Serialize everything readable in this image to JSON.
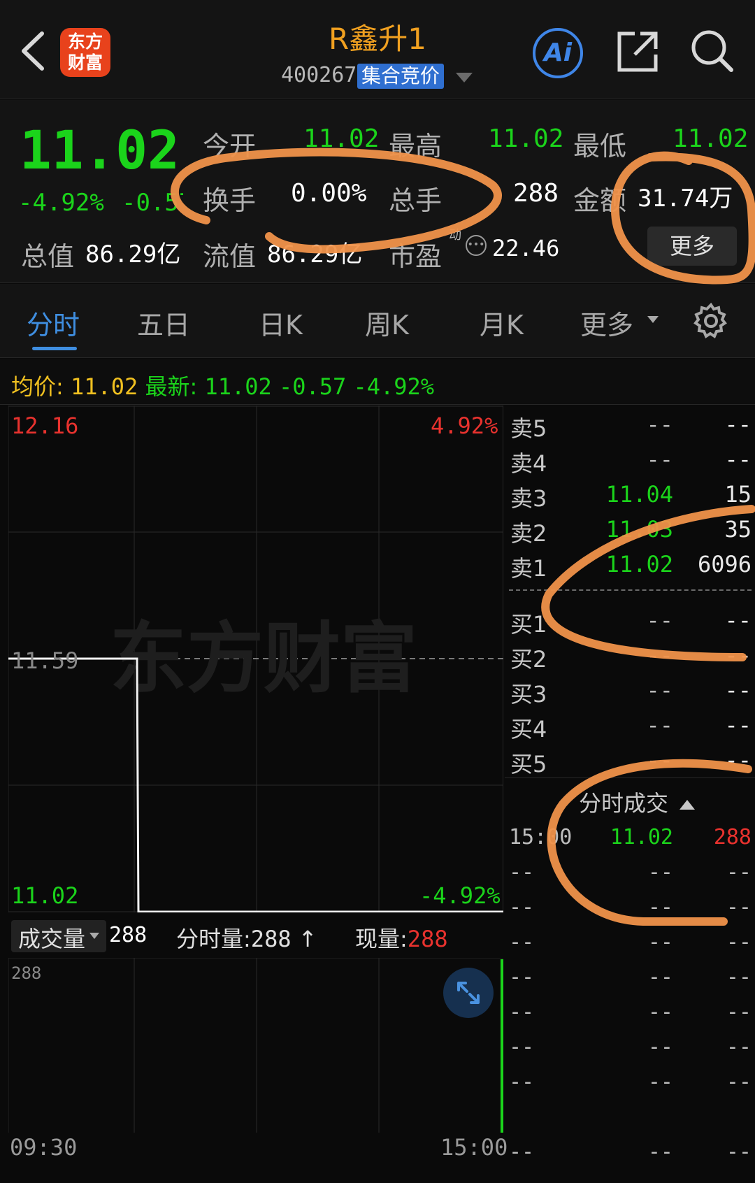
{
  "header": {
    "back_icon": "chevron-left-icon",
    "logo_line1": "东方",
    "logo_line2": "财富",
    "stock_name": "R鑫升1",
    "stock_code": "400267",
    "status_badge": "集合竞价",
    "ai_label": "Ai",
    "share_icon": "share-icon",
    "search_icon": "search-icon"
  },
  "quote": {
    "price": "11.02",
    "change_pct": "-4.92%",
    "change": "-0.57",
    "open_label": "今开",
    "open": "11.02",
    "high_label": "最高",
    "high": "11.02",
    "low_label": "最低",
    "low": "11.02",
    "turnover_label": "换手",
    "turnover": "0.00%",
    "volume_label": "总手",
    "volume": "288",
    "amount_label": "金额",
    "amount": "31.74万",
    "total_mv_label": "总值",
    "total_mv": "86.29亿",
    "float_mv_label": "流值",
    "float_mv": "86.29亿",
    "pe_label": "市盈",
    "pe_superscript": "动",
    "pe": "22.46",
    "more_button": "更多"
  },
  "tabs": [
    {
      "label": "分时"
    },
    {
      "label": "五日"
    },
    {
      "label": "日K"
    },
    {
      "label": "周K"
    },
    {
      "label": "月K"
    },
    {
      "label": "更多"
    }
  ],
  "price_line": {
    "avg_label": "均价:",
    "avg": "11.02",
    "latest_label": "最新:",
    "latest": "11.02",
    "change": "-0.57",
    "change_pct": "-4.92%"
  },
  "chart": {
    "top_price": "12.16",
    "top_pct": "4.92%",
    "mid_price": "11.59",
    "bottom_price": "11.02",
    "bottom_pct": "-4.92%",
    "watermark": "东方财富"
  },
  "volume_bar": {
    "selector_label": "成交量",
    "selector_value": "288",
    "minute_vol_label": "分时量:",
    "minute_vol": "288",
    "current_vol_label": "现量:",
    "current_vol": "288",
    "axis_max": "288",
    "time_start": "09:30",
    "time_end": "15:00"
  },
  "order_book": {
    "asks": [
      {
        "name": "卖5",
        "price": "--",
        "qty": "--"
      },
      {
        "name": "卖4",
        "price": "--",
        "qty": "--"
      },
      {
        "name": "卖3",
        "price": "11.04",
        "qty": "15"
      },
      {
        "name": "卖2",
        "price": "11.03",
        "qty": "35"
      },
      {
        "name": "卖1",
        "price": "11.02",
        "qty": "6096"
      }
    ],
    "bids": [
      {
        "name": "买1",
        "price": "--",
        "qty": "--"
      },
      {
        "name": "买2",
        "price": "--",
        "qty": "--"
      },
      {
        "name": "买3",
        "price": "--",
        "qty": "--"
      },
      {
        "name": "买4",
        "price": "--",
        "qty": "--"
      },
      {
        "name": "买5",
        "price": "--",
        "qty": "--"
      }
    ]
  },
  "trades": {
    "title": "分时成交",
    "rows": [
      {
        "time": "15:00",
        "price": "11.02",
        "vol": "288"
      },
      {
        "time": "--",
        "price": "--",
        "vol": "--"
      },
      {
        "time": "--",
        "price": "--",
        "vol": "--"
      },
      {
        "time": "--",
        "price": "--",
        "vol": "--"
      },
      {
        "time": "--",
        "price": "--",
        "vol": "--"
      },
      {
        "time": "--",
        "price": "--",
        "vol": "--"
      },
      {
        "time": "--",
        "price": "--",
        "vol": "--"
      },
      {
        "time": "--",
        "price": "--",
        "vol": "--"
      },
      {
        "time": "--",
        "price": "--",
        "vol": "--"
      }
    ]
  }
}
